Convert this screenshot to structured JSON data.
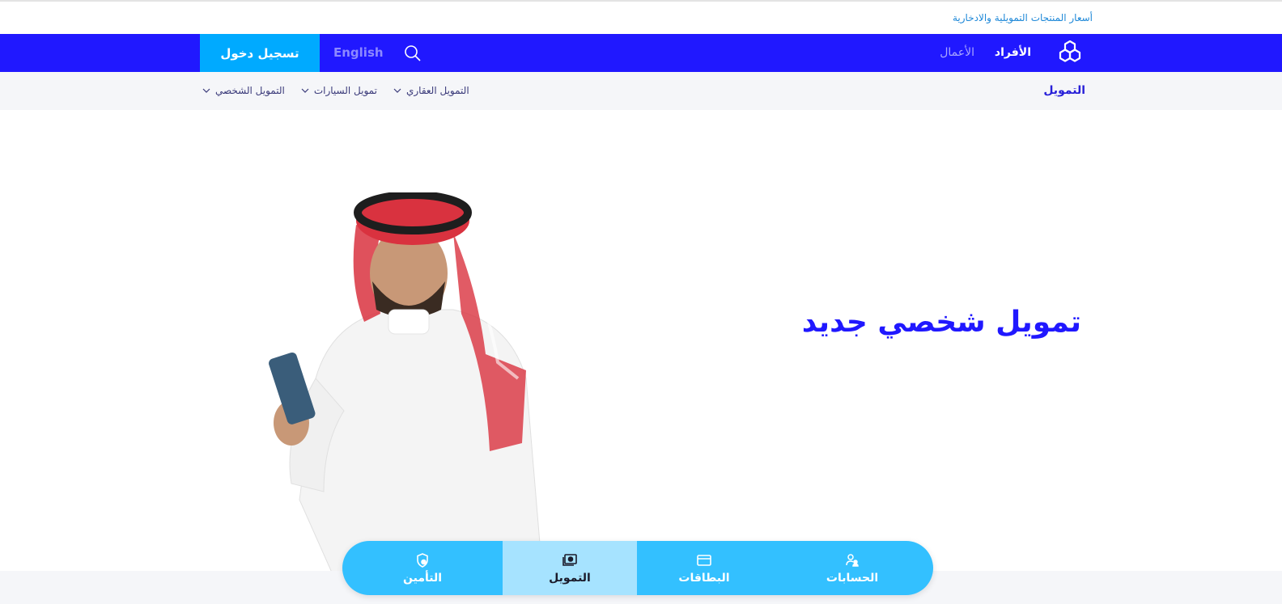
{
  "utility_bar": {
    "rates_link": "أسعار المنتجات التمويلية والادخارية"
  },
  "main_nav": {
    "logo_icon": "bank-logo-icon",
    "individuals": "الأفراد",
    "business": "الأعمال",
    "search_icon": "search-icon",
    "language": "English",
    "login": "تسجيل دخول"
  },
  "sub_nav": {
    "title": "التمويل",
    "items": [
      {
        "label": "التمويل العقاري"
      },
      {
        "label": "تمويل السيارات"
      },
      {
        "label": "التمويل الشخصي"
      }
    ]
  },
  "hero": {
    "title": "تمويل شخصي جديد",
    "image_alt": "man-in-thobe-using-phone"
  },
  "bottom_tabs": [
    {
      "label": "الحسابات",
      "icon": "accounts-icon",
      "active": false
    },
    {
      "label": "البطاقات",
      "icon": "card-icon",
      "active": false
    },
    {
      "label": "التمويل",
      "icon": "cash-icon",
      "active": true
    },
    {
      "label": "التأمين",
      "icon": "shield-icon",
      "active": false
    }
  ],
  "colors": {
    "primary": "#2018ff",
    "login_bg": "#00aaff",
    "tabbar_bg": "#33c0ff",
    "tab_active_bg": "#a6e3ff",
    "subnav_bg": "#f5f6f9"
  }
}
